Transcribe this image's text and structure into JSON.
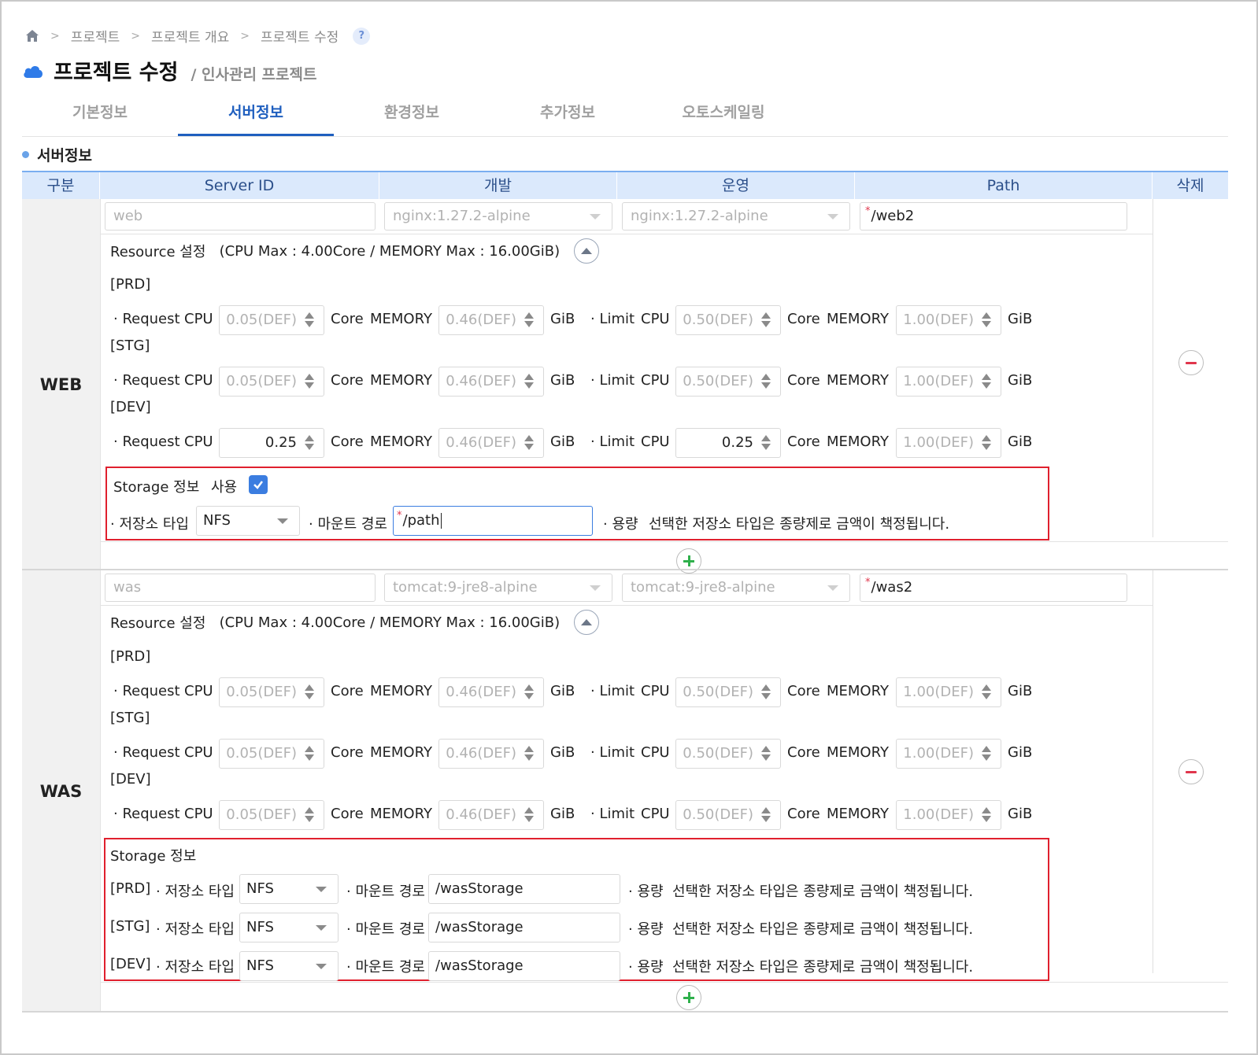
{
  "breadcrumb": [
    "프로젝트",
    "프로젝트 개요",
    "프로젝트 수정"
  ],
  "help_label": "?",
  "title": "프로젝트 수정",
  "subtitle": "/ 인사관리 프로젝트",
  "tabs": [
    "기본정보",
    "서버정보",
    "환경정보",
    "추가정보",
    "오토스케일링"
  ],
  "active_tab": "서버정보",
  "section_title": "서버정보",
  "table_headers": [
    "구분",
    "Server ID",
    "개발",
    "운영",
    "Path",
    "삭제"
  ],
  "labels": {
    "resource": "Resource 설정",
    "resource_max": "(CPU Max : 4.00Core / MEMORY Max : 16.00GiB)",
    "request": "· Request",
    "limit": "· Limit",
    "cpu": "CPU",
    "core": "Core",
    "memory": "MEMORY",
    "gib": "GiB",
    "storage": "Storage 정보",
    "use": "사용",
    "storage_type": "· 저장소 타입",
    "mount_path": "· 마운트 경로",
    "capacity": "· 용량",
    "capacity_note": "선택한 저장소 타입은 종량제로 금액이 책정됩니다."
  },
  "web": {
    "group": "WEB",
    "server_id": "web",
    "dev_image": "nginx:1.27.2-alpine",
    "prod_image": "nginx:1.27.2-alpine",
    "path": "/web2",
    "envs": [
      {
        "label": "[PRD]",
        "req_cpu": "0.05(DEF)",
        "req_mem": "0.46(DEF)",
        "lim_cpu": "0.50(DEF)",
        "lim_mem": "1.00(DEF)"
      },
      {
        "label": "[STG]",
        "req_cpu": "0.05(DEF)",
        "req_mem": "0.46(DEF)",
        "lim_cpu": "0.50(DEF)",
        "lim_mem": "1.00(DEF)"
      },
      {
        "label": "[DEV]",
        "req_cpu": "0.25",
        "req_mem": "0.46(DEF)",
        "lim_cpu": "0.25",
        "lim_mem": "1.00(DEF)"
      }
    ],
    "storage_use_checked": true,
    "storage_type": "NFS",
    "mount_path": "/path"
  },
  "was": {
    "group": "WAS",
    "server_id": "was",
    "dev_image": "tomcat:9-jre8-alpine",
    "prod_image": "tomcat:9-jre8-alpine",
    "path": "/was2",
    "envs": [
      {
        "label": "[PRD]",
        "req_cpu": "0.05(DEF)",
        "req_mem": "0.46(DEF)",
        "lim_cpu": "0.50(DEF)",
        "lim_mem": "1.00(DEF)"
      },
      {
        "label": "[STG]",
        "req_cpu": "0.05(DEF)",
        "req_mem": "0.46(DEF)",
        "lim_cpu": "0.50(DEF)",
        "lim_mem": "1.00(DEF)"
      },
      {
        "label": "[DEV]",
        "req_cpu": "0.05(DEF)",
        "req_mem": "0.46(DEF)",
        "lim_cpu": "0.50(DEF)",
        "lim_mem": "1.00(DEF)"
      }
    ],
    "storage": [
      {
        "label": "[PRD]",
        "type": "NFS",
        "mount": "/wasStorage"
      },
      {
        "label": "[STG]",
        "type": "NFS",
        "mount": "/wasStorage"
      },
      {
        "label": "[DEV]",
        "type": "NFS",
        "mount": "/wasStorage"
      }
    ]
  },
  "icons": [
    "home-icon",
    "chevron-right-icon",
    "help-icon",
    "cloud-icon",
    "collapse-up-icon",
    "minus-circle-icon",
    "plus-circle-icon",
    "checkbox-checked-icon",
    "spinner-arrows-icon",
    "dropdown-caret-icon"
  ],
  "colors": {
    "accent": "#1f5fbf",
    "header_bg": "#dbe9fc",
    "highlight_box": "#e0202e",
    "add": "#2fb04c",
    "delete": "#e0364c"
  }
}
